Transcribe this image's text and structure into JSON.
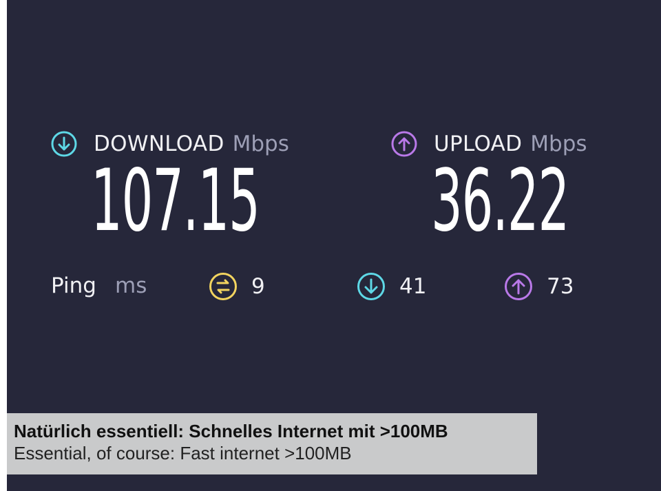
{
  "colors": {
    "panel_background": "#26273a",
    "download_accent": "#5ed8e6",
    "upload_accent": "#b979e8",
    "ping_idle_accent": "#f2d45f",
    "caption_background": "#c9cacb"
  },
  "download": {
    "icon": "arrow-down-circle-icon",
    "label": "DOWNLOAD",
    "unit": "Mbps",
    "value": "107.15"
  },
  "upload": {
    "icon": "arrow-up-circle-icon",
    "label": "UPLOAD",
    "unit": "Mbps",
    "value": "36.22"
  },
  "ping": {
    "label": "Ping",
    "unit": "ms",
    "idle": {
      "icon": "ping-idle-icon",
      "value": "9"
    },
    "download": {
      "icon": "arrow-down-circle-icon",
      "value": "41"
    },
    "upload": {
      "icon": "arrow-up-circle-icon",
      "value": "73"
    }
  },
  "caption": {
    "line1": "Natürlich essentiell: Schnelles Internet mit >100MB",
    "line2": "Essential, of course: Fast internet >100MB"
  }
}
